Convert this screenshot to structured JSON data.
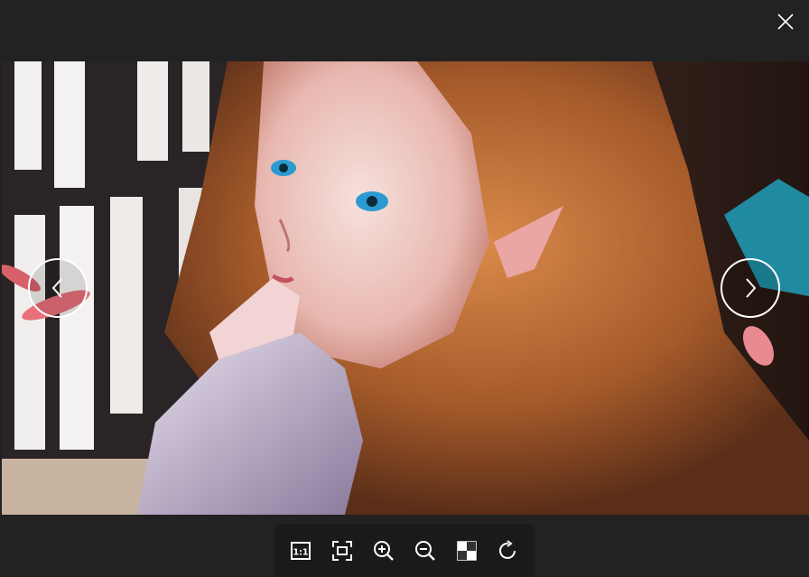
{
  "viewer": {
    "close_icon": "close-icon",
    "prev_icon": "chevron-left-icon",
    "next_icon": "chevron-right-icon",
    "image_alt": ""
  },
  "toolbar": {
    "items": [
      {
        "name": "actual-size",
        "icon": "one-to-one-icon",
        "label": "1:1"
      },
      {
        "name": "fit-screen",
        "icon": "fit-screen-icon"
      },
      {
        "name": "zoom-in",
        "icon": "zoom-in-icon"
      },
      {
        "name": "zoom-out",
        "icon": "zoom-out-icon"
      },
      {
        "name": "transparency-background",
        "icon": "checkerboard-icon"
      },
      {
        "name": "rotate",
        "icon": "rotate-clockwise-icon"
      }
    ]
  },
  "colors": {
    "background": "#222222",
    "toolbar": "#1a1a1a",
    "icon": "#ffffff"
  }
}
